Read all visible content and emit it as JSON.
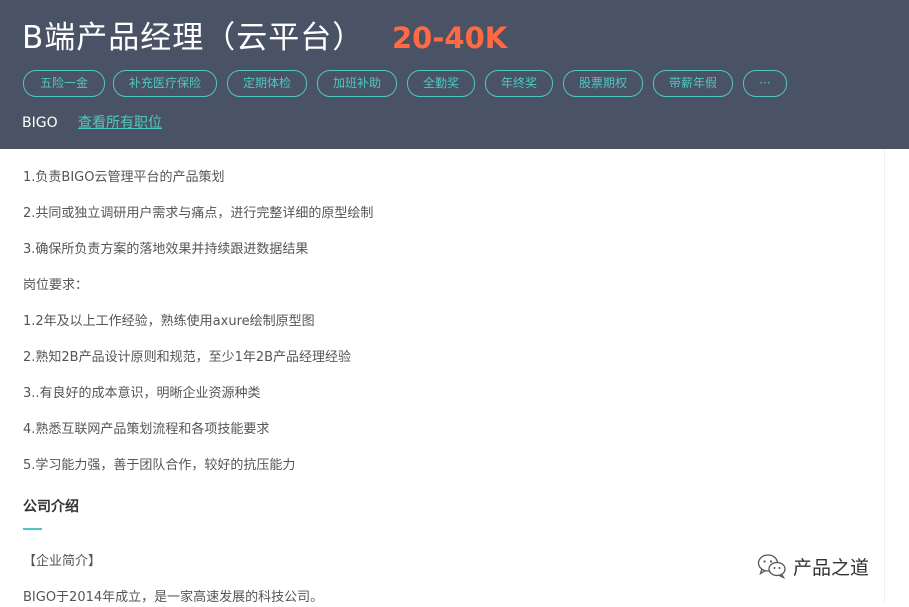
{
  "header": {
    "title": "B端产品经理（云平台）",
    "salary": "20-40K",
    "tags": [
      "五险一金",
      "补充医疗保险",
      "定期体检",
      "加班补助",
      "全勤奖",
      "年终奖",
      "股票期权",
      "带薪年假",
      "···"
    ],
    "company": "BIGO",
    "view_all": "查看所有职位"
  },
  "description": {
    "lines": [
      "1.负责BIGO云管理平台的产品策划",
      "2.共同或独立调研用户需求与痛点，进行完整详细的原型绘制",
      "3.确保所负责方案的落地效果并持续跟进数据结果",
      "岗位要求：",
      "1.2年及以上工作经验，熟练使用axure绘制原型图",
      "2.熟知2B产品设计原则和规范，至少1年2B产品经理经验",
      "3..有良好的成本意识，明晰企业资源种类",
      "4.熟悉互联网产品策划流程和各项技能要求",
      "5.学习能力强，善于团队合作，较好的抗压能力"
    ]
  },
  "company_intro": {
    "title": "公司介绍",
    "subtitle": "【企业简介】",
    "text": "BIGO于2014年成立，是一家高速发展的科技公司。"
  },
  "watermark": {
    "text": "产品之道",
    "icon": "wechat-icon"
  }
}
